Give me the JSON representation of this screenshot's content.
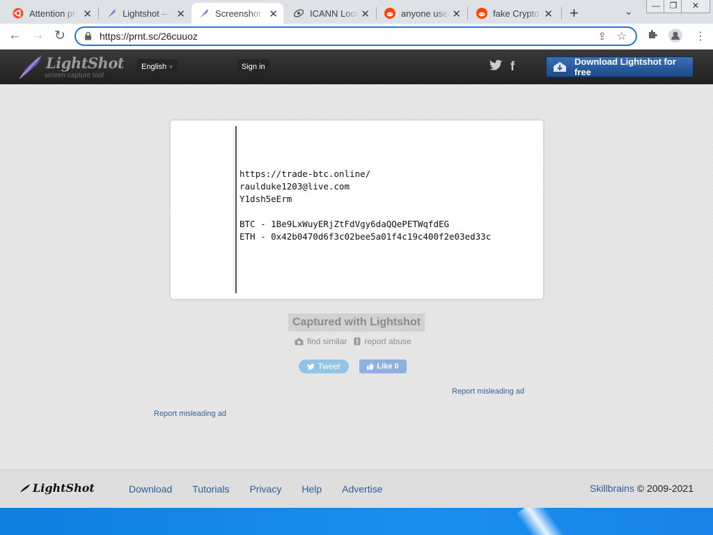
{
  "browser": {
    "tabs": [
      {
        "title": "Attention pr",
        "icon": "ubuntu-icon"
      },
      {
        "title": "Lightshot —",
        "icon": "feather-icon"
      },
      {
        "title": "Screenshot b",
        "icon": "feather-icon",
        "active": true
      },
      {
        "title": "ICANN Look",
        "icon": "icann-icon"
      },
      {
        "title": "anyone used",
        "icon": "reddit-icon"
      },
      {
        "title": "fake Crypto",
        "icon": "reddit-icon"
      }
    ],
    "url": "https://prnt.sc/26cuuoz"
  },
  "header": {
    "logo_name": "LightShot",
    "logo_tagline": "screen capture tool",
    "language": "English",
    "signin": "Sign in",
    "download": "Download Lightshot for free"
  },
  "screenshot": {
    "lines": [
      "https://trade-btc.online/",
      "raulduke1203@live.com",
      "Y1dsh5eErm",
      "",
      "BTC - 1Be9LxWuyERjZtFdVgy6daQQePETWqfdEG",
      "ETH - 0x42b0470d6f3c02bee5a01f4c19c400f2e03ed33c"
    ]
  },
  "actions": {
    "captured": "Captured with Lightshot",
    "find_similar": "find similar",
    "report_abuse": "report abuse",
    "tweet": "Tweet",
    "like": "Like 0",
    "report_ad_1": "Report misleading ad",
    "report_ad_2": "Report misleading ad"
  },
  "footer": {
    "logo": "LightShot",
    "nav": [
      "Download",
      "Tutorials",
      "Privacy",
      "Help",
      "Advertise"
    ],
    "company": "Skillbrains",
    "copyright": "© 2009-2021"
  },
  "colors": {
    "accent": "#1a73e8",
    "link": "#2e5c99",
    "header_bg": "#2b2b2b",
    "download_btn": "#2a5da2"
  }
}
